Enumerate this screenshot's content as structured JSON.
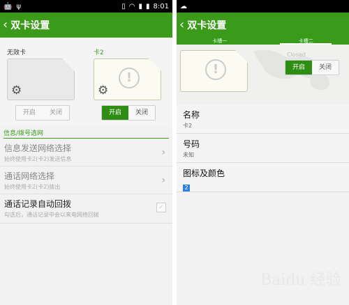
{
  "left": {
    "status": {
      "time": "8:01"
    },
    "title": "双卡设置",
    "sim1": {
      "label": "无效卡"
    },
    "sim2": {
      "label": "卡2"
    },
    "sim1_toggle": {
      "on": "开启",
      "off": "关闭"
    },
    "sim2_toggle": {
      "on": "开启",
      "off": "关闭"
    },
    "section": "信息/拨号选网",
    "rows": [
      {
        "title": "信息发送网络选择",
        "subtitle": "始终使用卡2(卡2)发送信息"
      },
      {
        "title": "通话网络选择",
        "subtitle": "始终使用卡2(卡2)拨出"
      },
      {
        "title": "通话记录自动回拨",
        "subtitle": "勾选后，通话记录中会以来电网络回拨"
      }
    ]
  },
  "right": {
    "title": "双卡设置",
    "tabs": [
      "卡槽一",
      "卡槽二"
    ],
    "closed_label": "Closed",
    "toggle": {
      "on": "开启",
      "off": "关闭"
    },
    "info": [
      {
        "label": "名称",
        "value": "卡2"
      },
      {
        "label": "号码",
        "value": "未知"
      },
      {
        "label": "图标及颜色",
        "badge": "2"
      }
    ]
  },
  "watermark": "Baidu 经验",
  "colors": {
    "accent": "#3a9a1a",
    "toggle_on": "#2e8d13",
    "badge": "#2f80e0"
  }
}
